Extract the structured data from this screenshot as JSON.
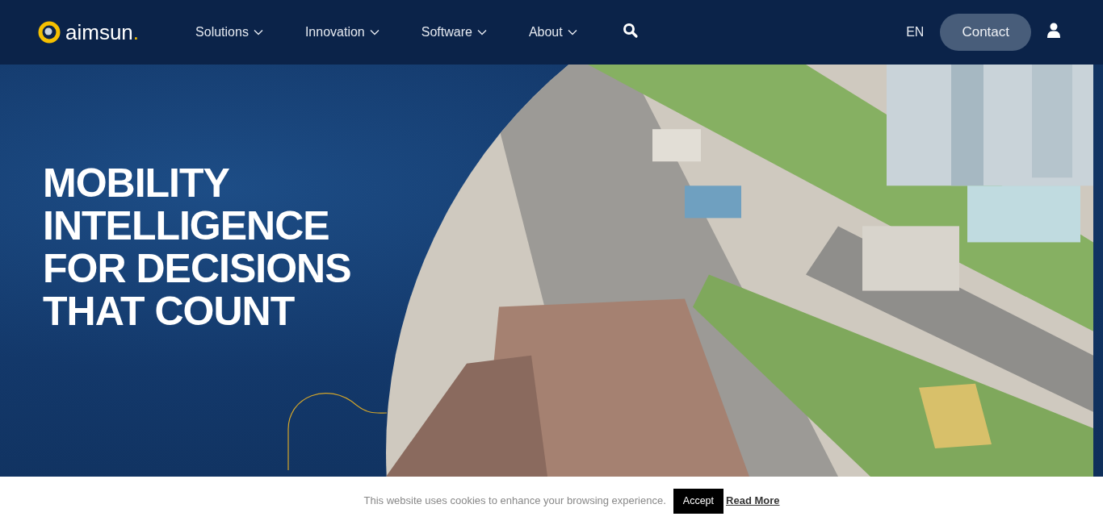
{
  "header": {
    "logo": {
      "word": "aimsun",
      "dot": "."
    },
    "nav": [
      {
        "label": "Solutions",
        "dropdown": true
      },
      {
        "label": "Innovation",
        "dropdown": true
      },
      {
        "label": "Software",
        "dropdown": true
      },
      {
        "label": "About",
        "dropdown": true
      }
    ],
    "language": "EN",
    "contact_button": "Contact"
  },
  "hero": {
    "title_lines": [
      "MOBILITY",
      "INTELLIGENCE",
      "FOR DECISIONS",
      "THAT COUNT"
    ]
  },
  "cookie_bar": {
    "message": "This website uses cookies to enhance your browsing experience.",
    "accept_button": "Accept",
    "read_more_link": "Read More"
  }
}
